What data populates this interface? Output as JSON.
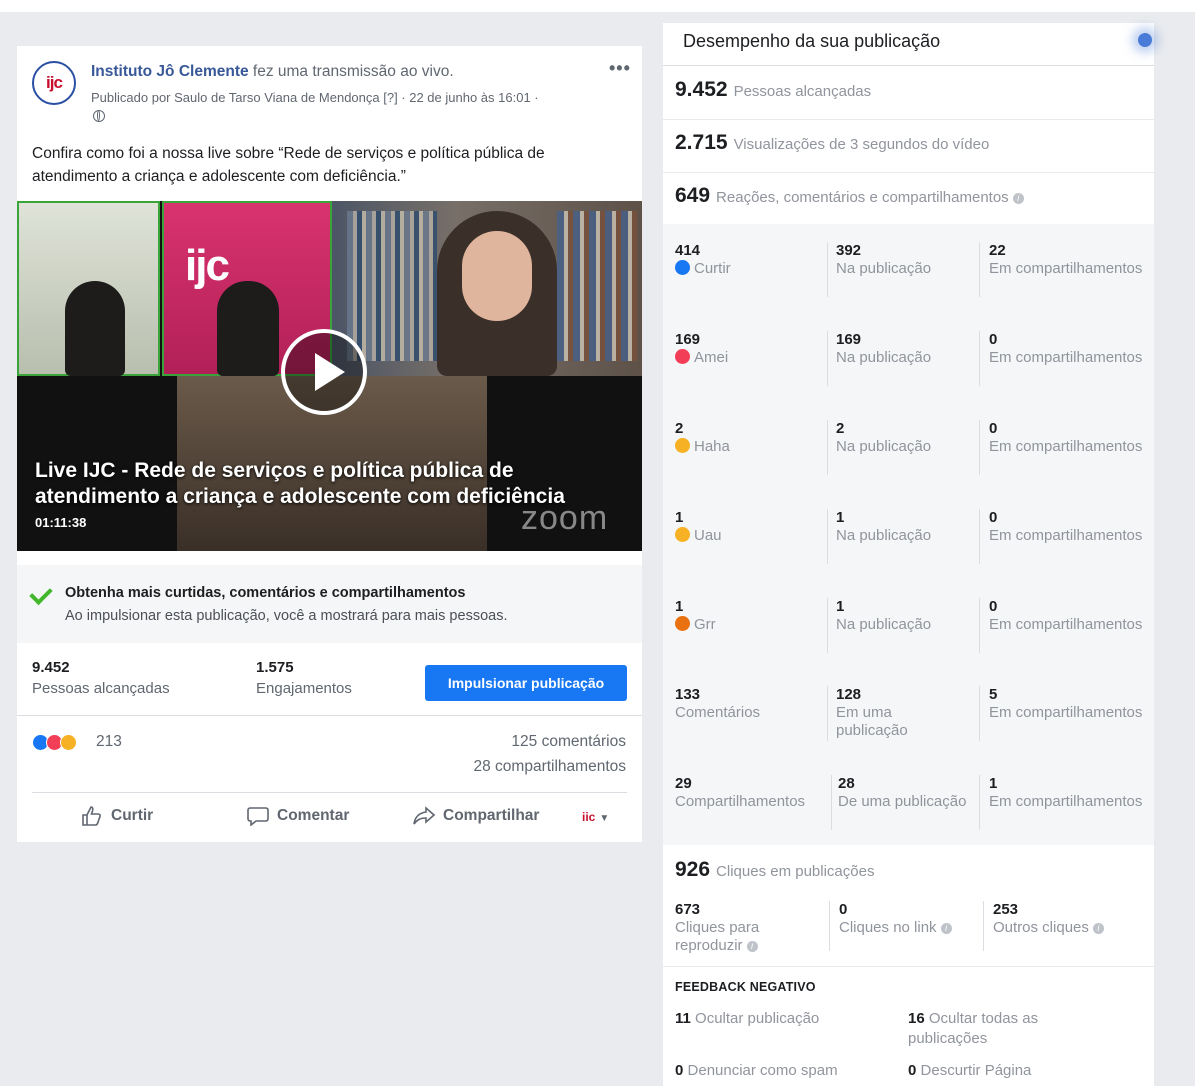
{
  "post": {
    "avatar_text": "ijc",
    "page_name": "Instituto Jô Clemente",
    "action_text": " fez uma transmissão ao vivo.",
    "published_by": "Publicado por Saulo de Tarso Viana de Mendonça [?] · 22 de junho às 16:01 ·",
    "more_label": "•••",
    "text": "Confira como foi a nossa live sobre “Rede de serviços e política pública de atendimento a criança e adolescente com deficiência.”",
    "video": {
      "title": "Live IJC - Rede de serviços e política pública de atendimento a criança e adolescente com deficiência",
      "duration": "01:11:38",
      "watermark": "zoom",
      "logo_text": "ijc"
    },
    "boost": {
      "title": "Obtenha mais curtidas, comentários e compartilhamentos",
      "subtitle": "Ao impulsionar esta publicação, você a mostrará para mais pessoas.",
      "button": "Impulsionar publicação"
    },
    "stats": {
      "reach_value": "9.452",
      "reach_label": "Pessoas alcançadas",
      "engagement_value": "1.575",
      "engagement_label": "Engajamentos"
    },
    "reactions_count": "213",
    "comments": "125 comentários",
    "shares": "28 compartilhamentos",
    "actions": {
      "like": "Curtir",
      "comment": "Comentar",
      "share": "Compartilhar",
      "page_logo": "iic"
    }
  },
  "panel": {
    "title": "Desempenho da sua publicação",
    "reach": {
      "value": "9.452",
      "label": "Pessoas alcançadas"
    },
    "views": {
      "value": "2.715",
      "label": "Visualizações de 3 segundos do vídeo"
    },
    "interactions": {
      "value": "649",
      "label": "Reações, comentários e compartilhamentos"
    },
    "breakdown": [
      {
        "total": "414",
        "name": "Curtir",
        "icon": "like-icon",
        "color": "#1877f2",
        "post": "392",
        "post_label": "Na publicação",
        "shares": "22",
        "shares_label": "Em compartilhamentos"
      },
      {
        "total": "169",
        "name": "Amei",
        "icon": "love-icon",
        "color": "#f33e58",
        "post": "169",
        "post_label": "Na publicação",
        "shares": "0",
        "shares_label": "Em compartilhamentos"
      },
      {
        "total": "2",
        "name": "Haha",
        "icon": "haha-icon",
        "color": "#f7b125",
        "post": "2",
        "post_label": "Na publicação",
        "shares": "0",
        "shares_label": "Em compartilhamentos"
      },
      {
        "total": "1",
        "name": "Uau",
        "icon": "wow-icon",
        "color": "#f7b125",
        "post": "1",
        "post_label": "Na publicação",
        "shares": "0",
        "shares_label": "Em compartilhamentos"
      },
      {
        "total": "1",
        "name": "Grr",
        "icon": "angry-icon",
        "color": "#e9710f",
        "post": "1",
        "post_label": "Na publicação",
        "shares": "0",
        "shares_label": "Em compartilhamentos"
      },
      {
        "total": "133",
        "name": "Comentários",
        "icon": "",
        "color": "",
        "post": "128",
        "post_label": "Em uma publicação",
        "shares": "5",
        "shares_label": "Em compartilhamentos"
      },
      {
        "total": "29",
        "name": "Compartilhamentos",
        "icon": "",
        "color": "",
        "post": "28",
        "post_label": "De uma publicação",
        "shares": "1",
        "shares_label": "Em compartilhamentos"
      }
    ],
    "clicks": {
      "value": "926",
      "label": "Cliques em publicações"
    },
    "click_breakdown": [
      {
        "value": "673",
        "label": "Cliques para reproduzir"
      },
      {
        "value": "0",
        "label": "Cliques no link"
      },
      {
        "value": "253",
        "label": "Outros cliques"
      }
    ],
    "negative": {
      "title": "FEEDBACK NEGATIVO",
      "hide_post_value": "11",
      "hide_post_label": "Ocultar publicação",
      "hide_all_value": "16",
      "hide_all_label": "Ocultar todas as publicações",
      "spam_value": "0",
      "spam_label": "Denunciar como spam",
      "unlike_value": "0",
      "unlike_label": "Descurtir Página"
    }
  }
}
